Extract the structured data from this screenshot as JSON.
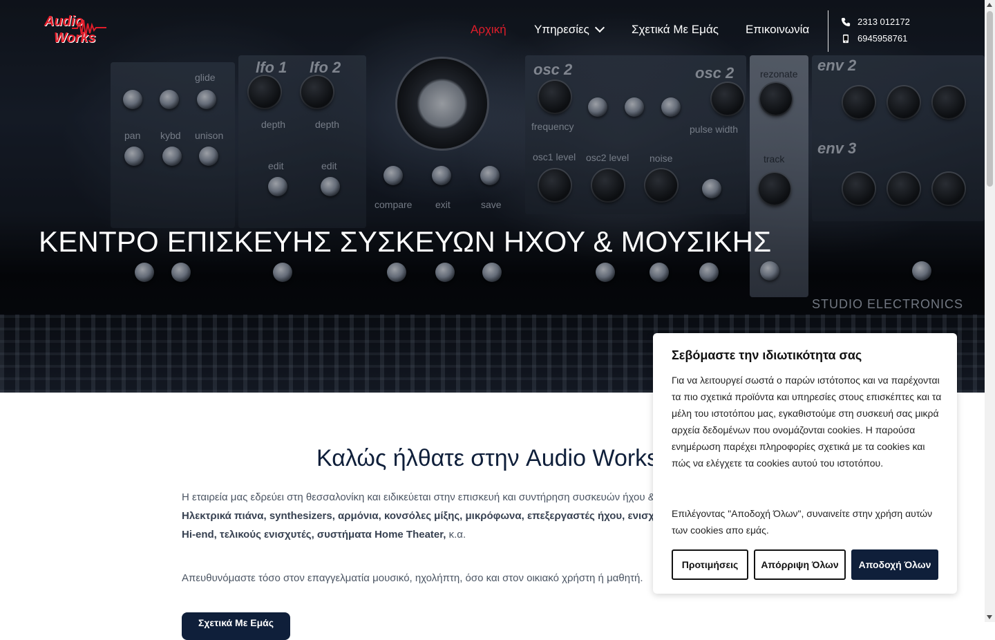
{
  "brand": {
    "line1": "Audio",
    "line2": "Works",
    "accent_color": "#e11d2a"
  },
  "nav": {
    "items": [
      {
        "label": "Αρχική",
        "active": true
      },
      {
        "label": "Υπηρεσίες",
        "has_dropdown": true
      },
      {
        "label": "Σχετικά Με Εμάς"
      },
      {
        "label": "Επικοινωνία"
      }
    ]
  },
  "contact": {
    "phone": "2313 012172",
    "mobile": "6945958761",
    "phone_icon": "phone-icon",
    "mobile_icon": "mobile-icon"
  },
  "hero": {
    "title": "ΚΕΝΤΡΟ ΕΠΙΣΚΕΥΗΣ ΣΥΣΚΕΥΩΝ ΗΧΟΥ & ΜΟΥΣΙΚΗΣ",
    "synth_labels": [
      "lfo 1",
      "lfo 2",
      "osc 2",
      "osc 2",
      "env 2",
      "env 3",
      "depth",
      "depth",
      "edit",
      "edit",
      "glide",
      "pan",
      "kybd",
      "unison",
      "frequency",
      "pulse width",
      "osc1 level",
      "osc2 level",
      "noise",
      "rezonate",
      "track",
      "compare",
      "exit",
      "save",
      "STUDIO ELECTRONICS"
    ]
  },
  "main": {
    "welcome_title": "Καλώς ήλθατε στην Audio Works",
    "para1_text": "Η εταιρεία μας εδρεύει στη θεσσαλονίκη και ειδικεύεται στην επισκευή και συντήρηση συσκευών ήχου &amp; μουσικής:",
    "para1_bold_line1": "Ηλεκτρικά πιάνα, synthesizers, αρμόνια, κονσόλες μίξης, μικρόφωνα, επεξεργαστές ήχου, ενισχυτές οργάνων,",
    "para1_bold_line2": "Hi-end, τελικούς ενισχυτές, συστήματα Home Theater,",
    "para1_tail": " κ.α.",
    "para2": "Απευθυνόμαστε τόσο στον επαγγελματία μουσικό, ηχολήπτη, όσο και στον οικιακό χρήστη ή μαθητή.",
    "cta_label": "Σχετικά Με Εμάς"
  },
  "cookie": {
    "title": "Σεβόμαστε την ιδιωτικότητα σας",
    "text1": "Για να λειτουργεί σωστά ο παρών ιστότοπος και να παρέχονται τα πιο σχετικά προϊόντα και υπηρεσίες στους επισκέπτες και τα μέλη του ιστοτόπου μας, εγκαθιστούμε στη συσκευή σας μικρά αρχεία δεδομένων που ονομάζονται cookies. Η παρούσα ενημέρωση παρέχει πληροφορίες σχετικά με τα cookies και πώς να ελέγχετε τα cookies αυτού του ιστοτόπου.",
    "text2": "Επιλέγοντας \"Αποδοχή Όλων\", συναινείτε στην χρήση αυτών των cookies απο εμάς.",
    "btn_preferences": "Προτιμήσεις",
    "btn_reject": "Απόρριψη Όλων",
    "btn_accept": "Αποδοχή Όλων"
  },
  "colors": {
    "primary_dark": "#0f1f3a",
    "active_nav": "#e11d2a"
  }
}
